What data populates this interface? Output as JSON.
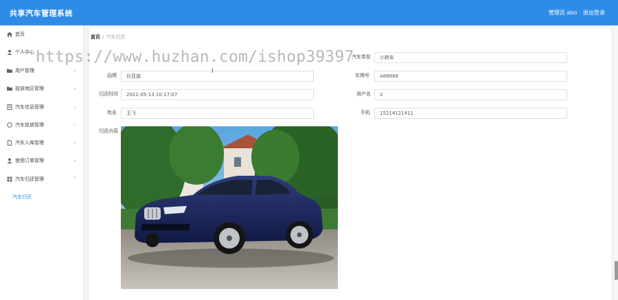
{
  "header": {
    "title": "共享汽车管理系统",
    "user": "管理员 abo",
    "logout": "退出登录"
  },
  "sidebar": {
    "items": [
      {
        "label": "首页",
        "icon": "home-icon"
      },
      {
        "label": "个人中心",
        "icon": "user-icon"
      },
      {
        "label": "用户管理",
        "icon": "folder-icon"
      },
      {
        "label": "投放地区管理",
        "icon": "folder-icon"
      },
      {
        "label": "汽车信息管理",
        "icon": "list-icon"
      },
      {
        "label": "汽车投放管理",
        "icon": "circle-icon"
      },
      {
        "label": "汽车入库管理",
        "icon": "document-icon"
      },
      {
        "label": "使用订单管理",
        "icon": "person-icon"
      },
      {
        "label": "汽车归还管理",
        "icon": "grid-icon"
      }
    ],
    "subitem": "汽车归还"
  },
  "breadcrumb": {
    "home": "首页",
    "separator": "/",
    "current": "汽车归还"
  },
  "form": {
    "type_label": "汽车类型",
    "type_value": "小轿车",
    "brand_label": "品牌",
    "brand_value": "比亚迪",
    "plate_label": "车牌号",
    "plate_value": "A88888",
    "time_label": "归还时间",
    "time_value": "2021-05-13 10:17:07",
    "username_label": "用户名",
    "username_value": "2",
    "name_label": "姓名",
    "name_value": "王飞",
    "phone_label": "手机",
    "phone_value": "15214121411",
    "content_label": "归还内容"
  },
  "watermark": "https://www.huzhan.com/ishop39397",
  "colors": {
    "header": "#2f8ce6",
    "active_sub": "#2f8ce6"
  }
}
